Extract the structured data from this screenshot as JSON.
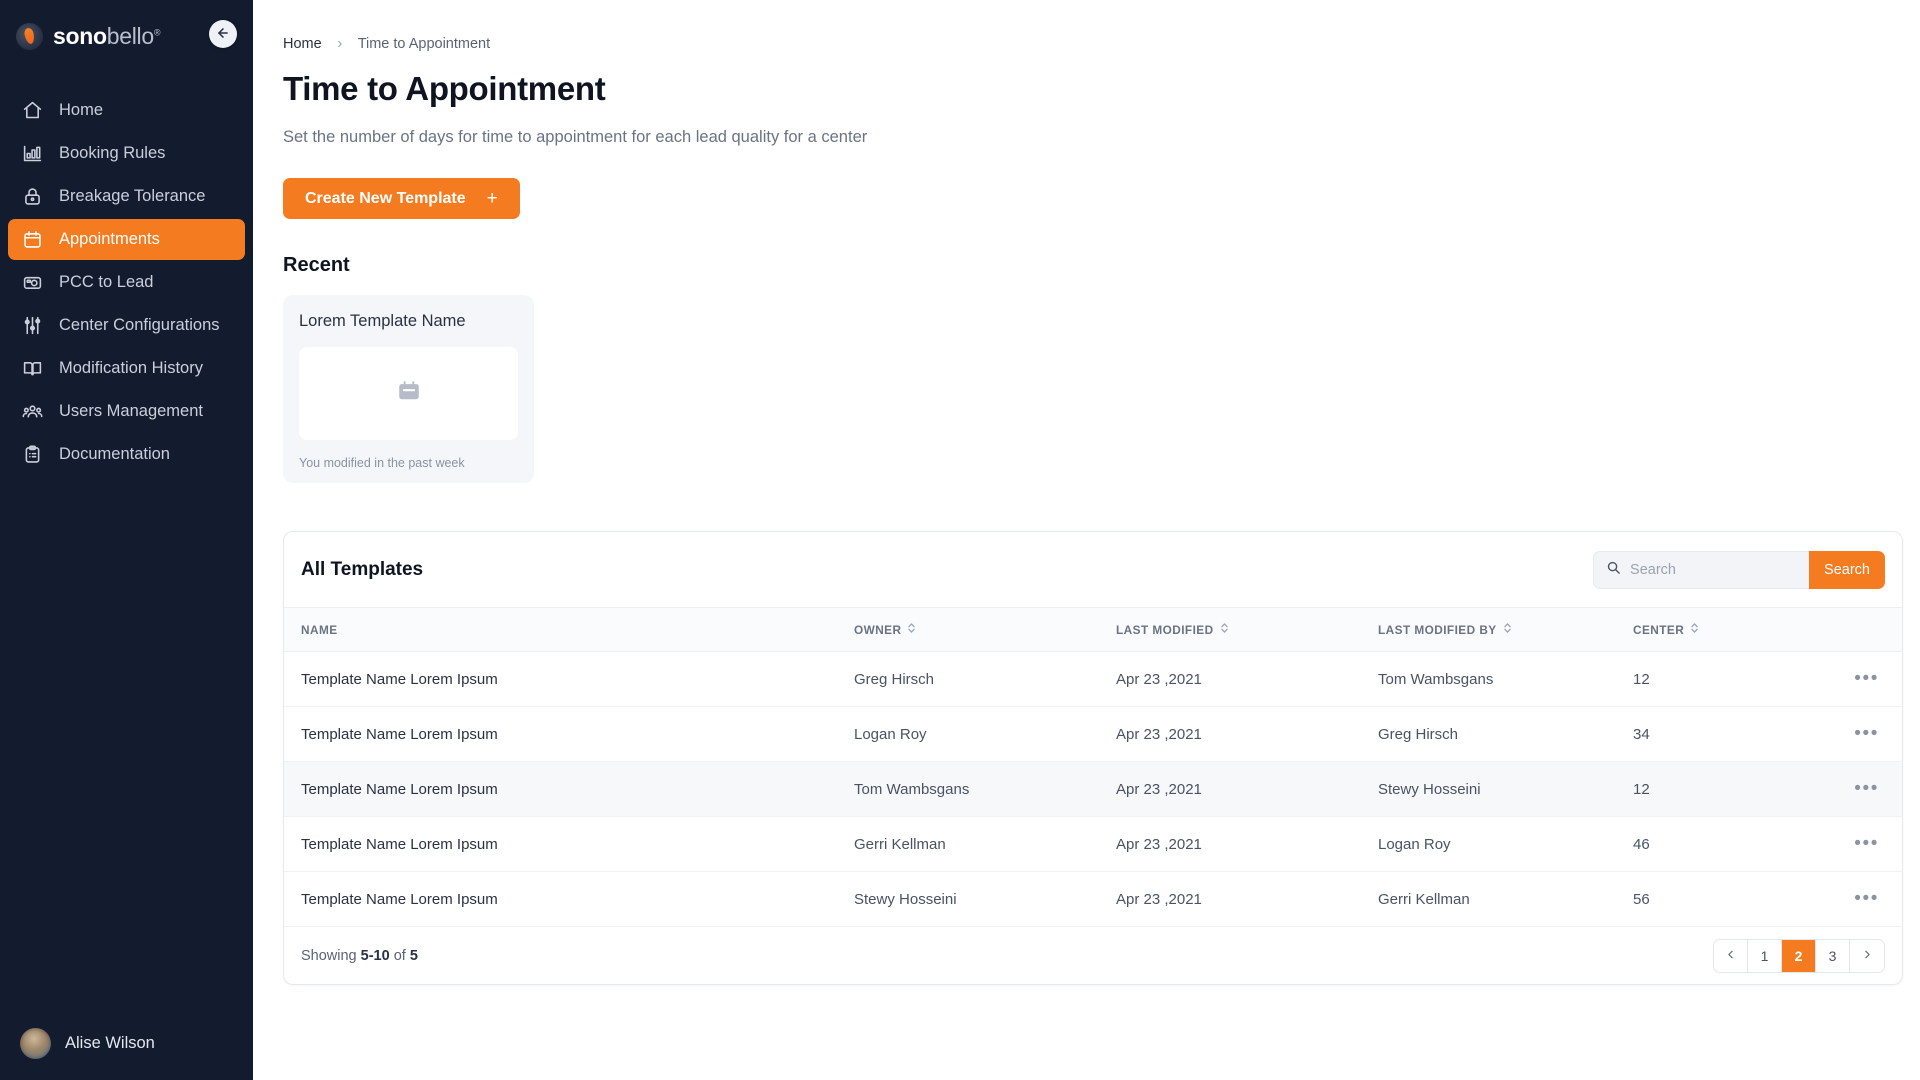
{
  "brand": {
    "part1": "sono",
    "part2": "bello",
    "trademark": "®"
  },
  "sidebar": {
    "collapse_label": "Collapse sidebar",
    "items": [
      {
        "label": "Home",
        "icon": "home-icon",
        "active": false
      },
      {
        "label": "Booking Rules",
        "icon": "bar-chart-icon",
        "active": false
      },
      {
        "label": "Breakage Tolerance",
        "icon": "lock-icon",
        "active": false
      },
      {
        "label": "Appointments",
        "icon": "calendar-icon",
        "active": true
      },
      {
        "label": "PCC to Lead",
        "icon": "camera-icon",
        "active": false
      },
      {
        "label": "Center Configurations",
        "icon": "sliders-icon",
        "active": false
      },
      {
        "label": "Modification History",
        "icon": "book-icon",
        "active": false
      },
      {
        "label": "Users Management",
        "icon": "users-icon",
        "active": false
      },
      {
        "label": "Documentation",
        "icon": "clipboard-icon",
        "active": false
      }
    ],
    "user": {
      "name": "Alise Wilson",
      "avatar": "user-avatar"
    }
  },
  "breadcrumb": {
    "home": "Home",
    "separator": "›",
    "current": "Time to Appointment"
  },
  "page": {
    "title": "Time to Appointment",
    "subtitle": "Set the number of days for time to appointment for each lead quality for a center",
    "create_button": "Create New Template",
    "create_button_icon": "plus-icon",
    "recent_heading": "Recent"
  },
  "recent_cards": [
    {
      "name": "Lorem Template Name",
      "thumb_icon": "calendar-icon",
      "meta": "You modified in the past week"
    }
  ],
  "templates_panel": {
    "title": "All Templates",
    "search": {
      "placeholder": "Search",
      "value": "",
      "icon": "search-icon",
      "button_label": "Search"
    },
    "columns": [
      {
        "label": "NAME",
        "sortable": false
      },
      {
        "label": "OWNER",
        "sortable": true
      },
      {
        "label": "LAST MODIFIED",
        "sortable": true
      },
      {
        "label": "LAST MODIFIED BY",
        "sortable": true
      },
      {
        "label": "CENTER",
        "sortable": true
      }
    ],
    "rows": [
      {
        "name": "Template Name Lorem Ipsum",
        "owner": "Greg Hirsch",
        "last_modified": "Apr 23 ,2021",
        "last_modified_by": "Tom Wambsgans",
        "center": "12",
        "actions": "•••"
      },
      {
        "name": "Template Name Lorem Ipsum",
        "owner": "Logan Roy",
        "last_modified": "Apr 23 ,2021",
        "last_modified_by": "Greg Hirsch",
        "center": "34",
        "actions": "•••"
      },
      {
        "name": "Template Name Lorem Ipsum",
        "owner": "Tom Wambsgans",
        "last_modified": "Apr 23 ,2021",
        "last_modified_by": "Stewy Hosseini",
        "center": "12",
        "actions": "•••"
      },
      {
        "name": "Template Name Lorem Ipsum",
        "owner": "Gerri Kellman",
        "last_modified": "Apr 23 ,2021",
        "last_modified_by": "Logan Roy",
        "center": "46",
        "actions": "•••"
      },
      {
        "name": "Template Name Lorem Ipsum",
        "owner": "Stewy Hosseini",
        "last_modified": "Apr 23 ,2021",
        "last_modified_by": "Gerri Kellman",
        "center": "56",
        "actions": "•••"
      }
    ],
    "footer": {
      "showing_prefix": "Showing ",
      "showing_range": "5-10",
      "showing_middle": " of ",
      "showing_total": "5",
      "pagination": {
        "prev_icon": "chevron-left-icon",
        "pages": [
          "1",
          "2",
          "3"
        ],
        "active_page": "2",
        "next_icon": "chevron-right-icon"
      }
    }
  },
  "colors": {
    "accent": "#F47B20",
    "sidebar_bg": "#131B2E",
    "page_bg": "#FFFFFF",
    "row_alt": "#F7F8FA"
  }
}
